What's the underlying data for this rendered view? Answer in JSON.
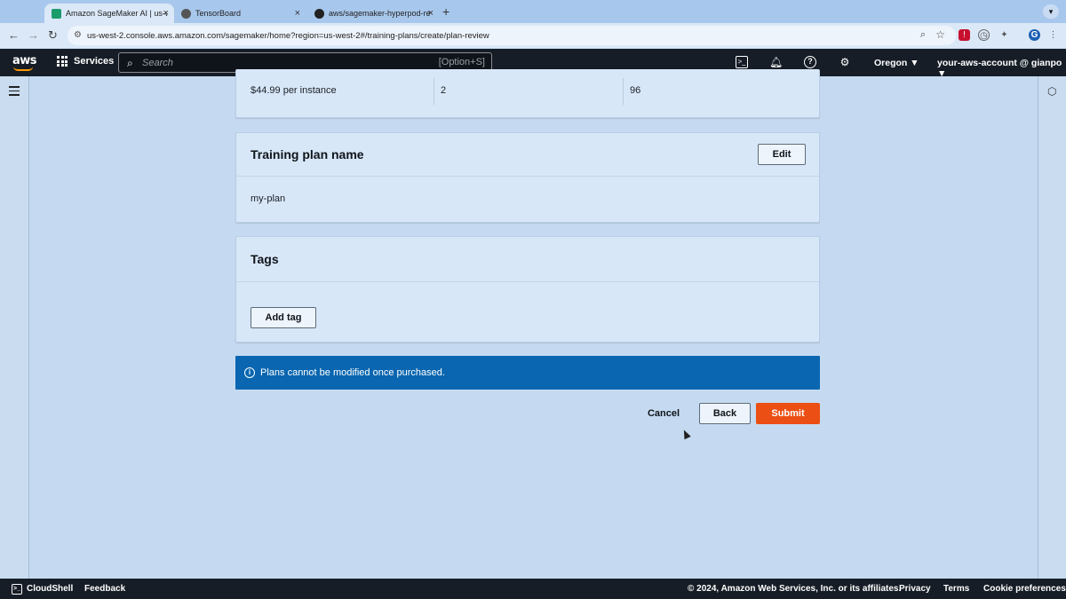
{
  "browser": {
    "tabs": [
      {
        "title": "Amazon SageMaker AI | us-w",
        "close": "×",
        "favicon_color": "#1a9c6b"
      },
      {
        "title": "TensorBoard",
        "close": "×",
        "favicon_color": "#555555"
      },
      {
        "title": "aws/sagemaker-hyperpod-re",
        "close": "×",
        "favicon_color": "#222222"
      }
    ],
    "new_tab": "+",
    "tab_menu": "▾",
    "url": "us-west-2.console.aws.amazon.com/sagemaker/home?region=us-west-2#/training-plans/create/plan-review",
    "profile_initial": "G"
  },
  "aws_nav": {
    "logo": "aws",
    "services_label": "Services",
    "search_placeholder": "Search",
    "search_shortcut": "[Option+S]",
    "region": "Oregon ▼",
    "account": "your-aws-account @ gianpo ▼"
  },
  "summary_row": {
    "rate": "$44.99 per instance",
    "instance_count": "2",
    "total_hours": "96"
  },
  "plan_name_section": {
    "title": "Training plan name",
    "edit_label": "Edit",
    "value": "my-plan"
  },
  "tags_section": {
    "title": "Tags",
    "add_tag_label": "Add tag"
  },
  "alert": {
    "message": "Plans cannot be modified once purchased."
  },
  "actions": {
    "cancel": "Cancel",
    "back": "Back",
    "submit": "Submit"
  },
  "colors": {
    "primary_action": "#ec4f13",
    "info_banner": "#0a66b0",
    "nav_background": "#161d26"
  },
  "footer": {
    "cloudshell": "CloudShell",
    "feedback": "Feedback",
    "copyright": "© 2024, Amazon Web Services, Inc. or its affiliates.",
    "privacy": "Privacy",
    "terms": "Terms",
    "cookies": "Cookie preferences"
  }
}
